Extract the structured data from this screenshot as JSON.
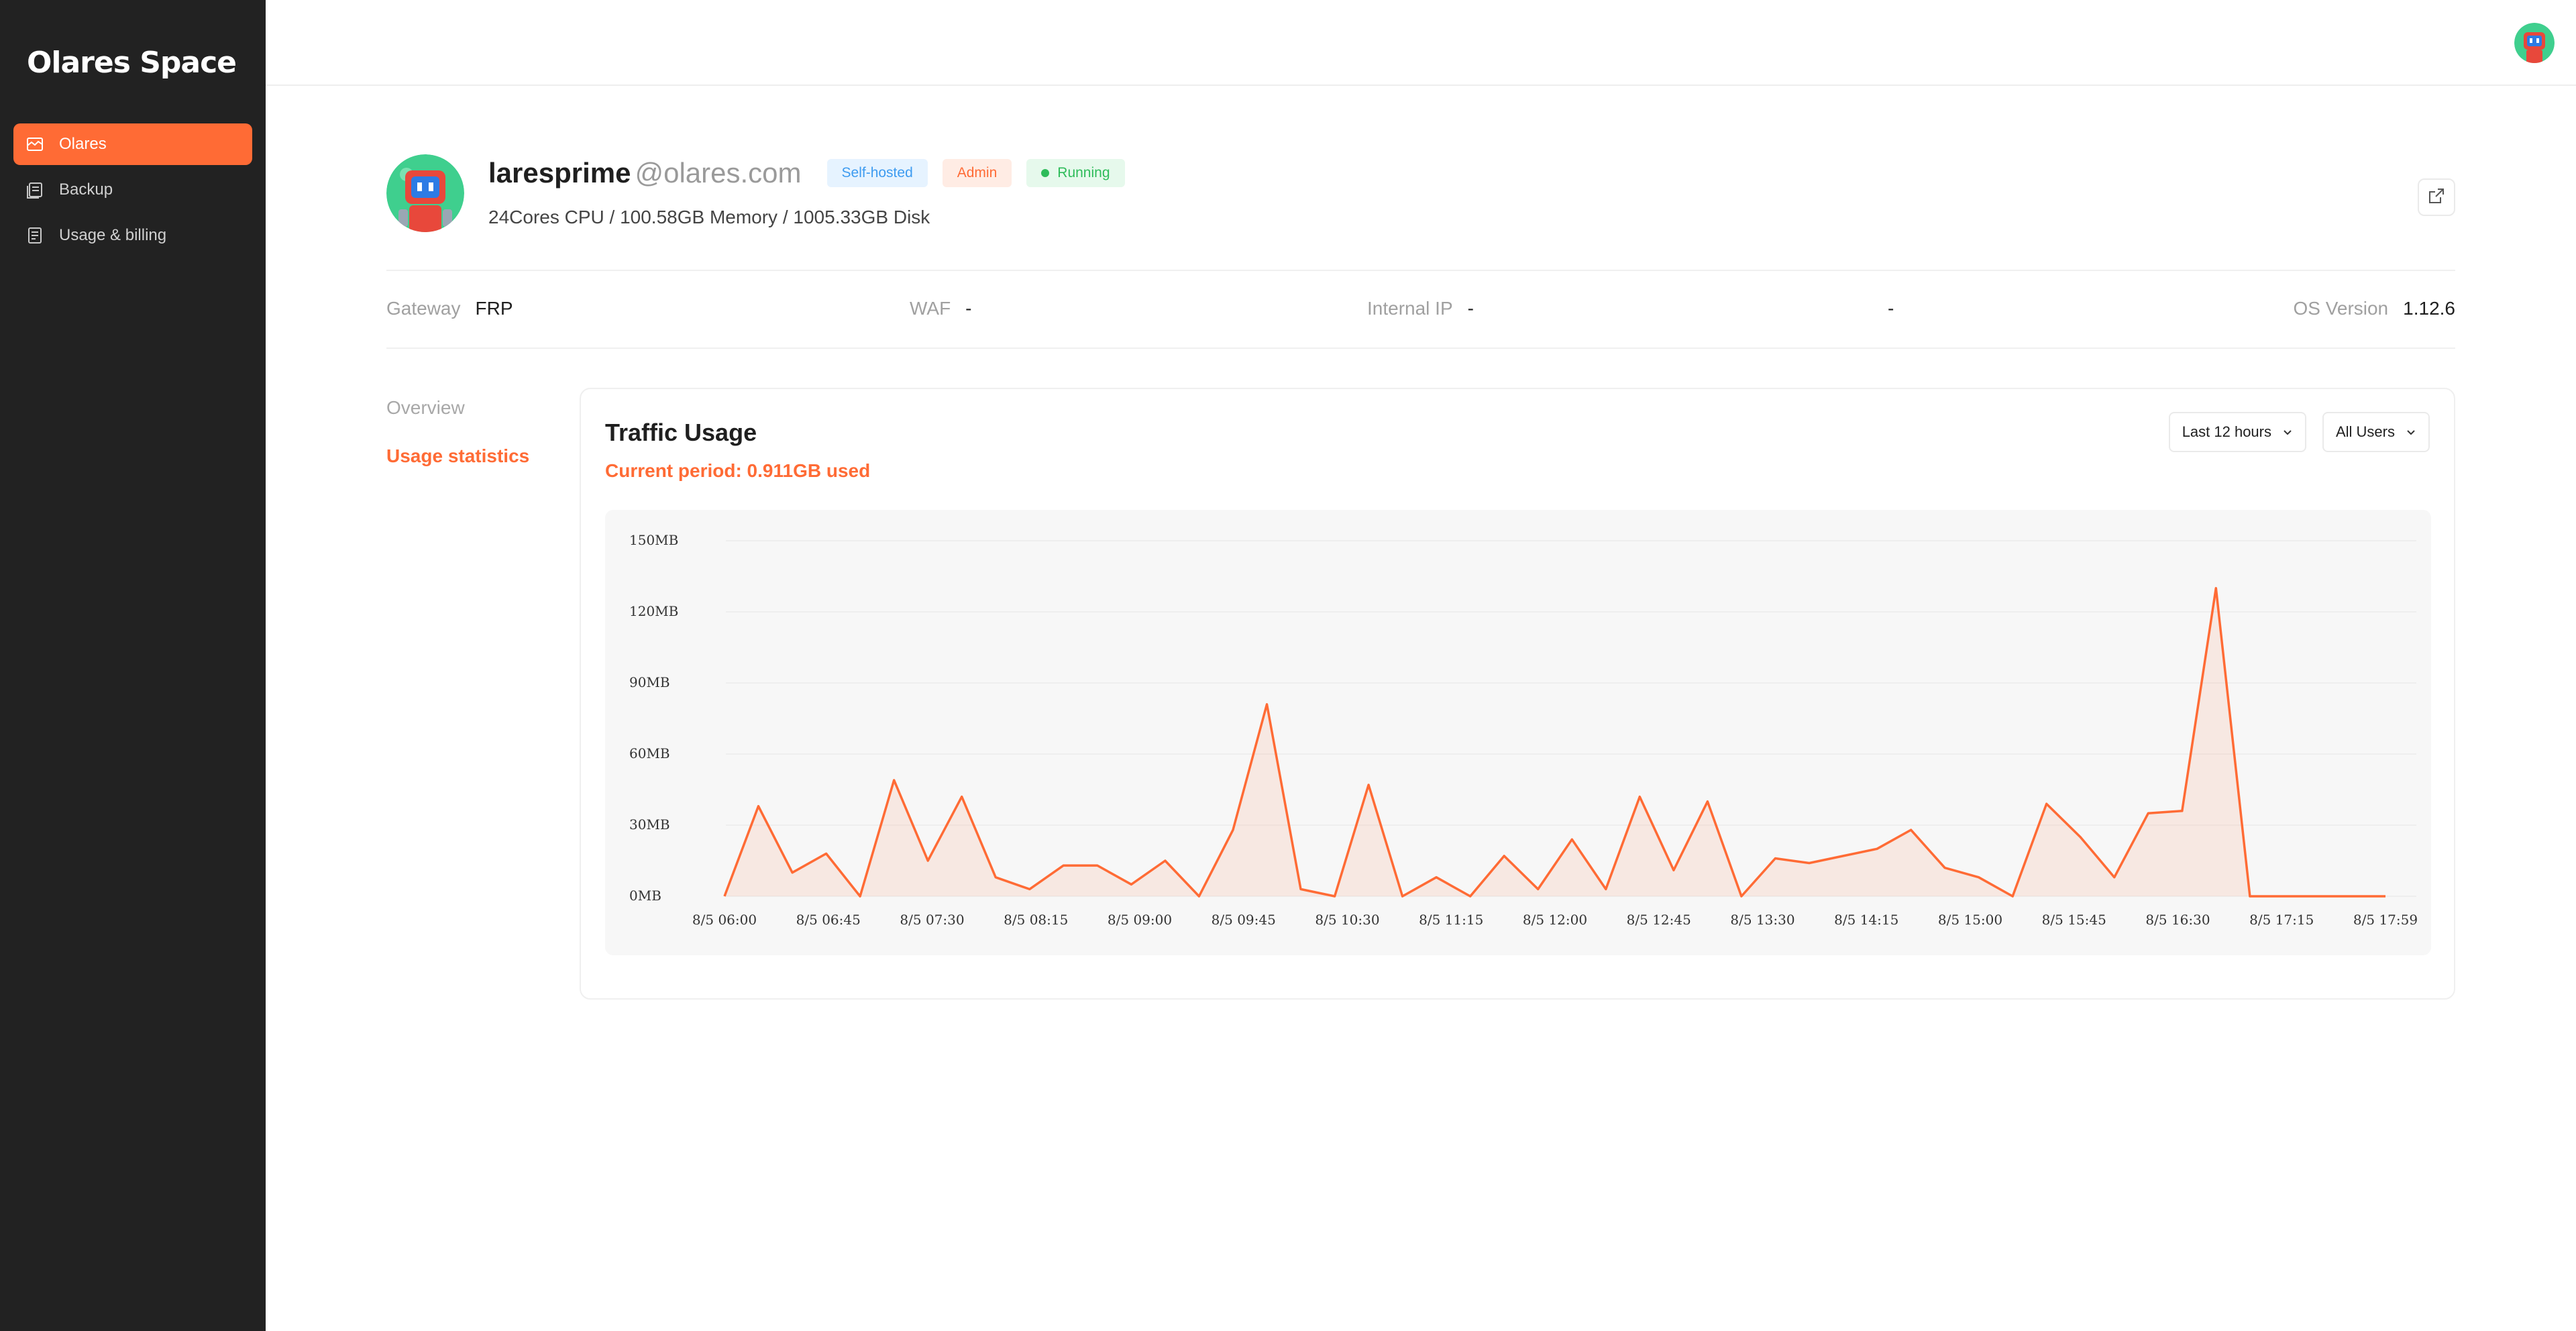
{
  "sidebar": {
    "brand": "Olares Space",
    "items": [
      {
        "label": "Olares",
        "icon": "dashboard-icon",
        "active": true
      },
      {
        "label": "Backup",
        "icon": "backup-icon",
        "active": false
      },
      {
        "label": "Usage & billing",
        "icon": "billing-icon",
        "active": false
      }
    ]
  },
  "profile": {
    "username": "laresprime",
    "domain": "@olares.com",
    "badges": {
      "self_hosted": "Self-hosted",
      "admin": "Admin",
      "running": "Running"
    },
    "specs": "24Cores CPU / 100.58GB Memory / 1005.33GB Disk"
  },
  "info": {
    "gateway_label": "Gateway",
    "gateway_value": "FRP",
    "waf_label": "WAF",
    "waf_value": "-",
    "internal_ip_label": "Internal IP",
    "internal_ip_value": "-",
    "extra_value": "-",
    "os_label": "OS Version",
    "os_value": "1.12.6"
  },
  "subnav": {
    "overview": "Overview",
    "usage": "Usage statistics"
  },
  "card": {
    "title": "Traffic Usage",
    "current_period": "Current period: 0.911GB used",
    "range_select": "Last 12 hours",
    "users_select": "All Users"
  },
  "colors": {
    "accent": "#ff6b35",
    "sidebar_bg": "#222222",
    "running": "#2ebc5a",
    "self_hosted": "#3d9bf0"
  },
  "chart_data": {
    "type": "area",
    "y_ticks": [
      "0MB",
      "30MB",
      "60MB",
      "90MB",
      "120MB",
      "150MB"
    ],
    "ylim": [
      0,
      150
    ],
    "x_tick_labels": [
      "8/5 06:00",
      "8/5 06:45",
      "8/5 07:30",
      "8/5 08:15",
      "8/5 09:00",
      "8/5 09:45",
      "8/5 10:30",
      "8/5 11:15",
      "8/5 12:00",
      "8/5 12:45",
      "8/5 13:30",
      "8/5 14:15",
      "8/5 15:00",
      "8/5 15:45",
      "8/5 16:30",
      "8/5 17:15",
      "8/5 17:59"
    ],
    "series": [
      {
        "values": [
          0,
          38,
          10,
          18,
          0,
          49,
          15,
          42,
          8,
          3,
          13,
          13,
          5,
          15,
          0,
          28,
          81,
          3,
          0,
          47,
          0,
          8,
          0,
          17,
          3,
          24,
          3,
          42,
          11,
          40,
          0,
          16,
          14,
          17,
          20,
          28,
          12,
          8,
          0,
          39,
          25,
          8,
          35,
          36,
          130,
          0,
          0,
          0,
          0,
          0
        ]
      }
    ]
  }
}
